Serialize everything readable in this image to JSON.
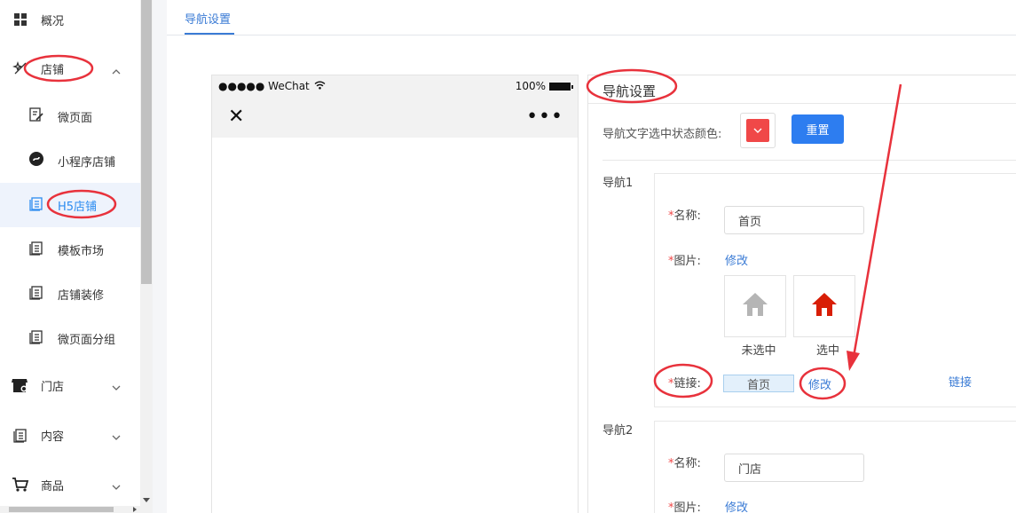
{
  "sidebar": {
    "items": [
      {
        "label": "概况",
        "icon": "grid-icon"
      },
      {
        "label": "店铺",
        "icon": "shop-spark-icon"
      },
      {
        "label": "门店",
        "icon": "store-gear-icon"
      },
      {
        "label": "内容",
        "icon": "content-icon"
      },
      {
        "label": "商品",
        "icon": "cart-icon"
      }
    ],
    "sub_items": [
      {
        "label": "微页面",
        "icon": "edit-page-icon"
      },
      {
        "label": "小程序店铺",
        "icon": "miniprogram-icon"
      },
      {
        "label": "H5店铺",
        "icon": "pages-icon"
      },
      {
        "label": "模板市场",
        "icon": "pages-icon"
      },
      {
        "label": "店铺装修",
        "icon": "pages-icon"
      },
      {
        "label": "微页面分组",
        "icon": "pages-icon"
      }
    ]
  },
  "tabs": {
    "active": "导航设置"
  },
  "phone": {
    "carrier": "●●●●● WeChat",
    "battery": "100%",
    "close": "✕",
    "more": "•••"
  },
  "panel": {
    "title": "导航设置",
    "color_label": "导航文字选中状态颜色:",
    "selected_color": "#f04848",
    "reset_label": "重置",
    "navs": [
      {
        "label": "导航1",
        "name_label": "名称:",
        "name_value": "首页",
        "image_label": "图片:",
        "image_edit": "修改",
        "unselected_caption": "未选中",
        "selected_caption": "选中",
        "link_label": "链接:",
        "link_value": "首页",
        "link_edit": "修改",
        "link_right": "链接"
      },
      {
        "label": "导航2",
        "name_label": "名称:",
        "name_value": "门店",
        "image_label": "图片:",
        "image_edit": "修改"
      }
    ]
  },
  "colors": {
    "accent": "#3a7bd5",
    "button": "#2d7df0",
    "annotation": "#e8323c",
    "home_unselected": "#b5b5b5",
    "home_selected": "#d81e06"
  }
}
